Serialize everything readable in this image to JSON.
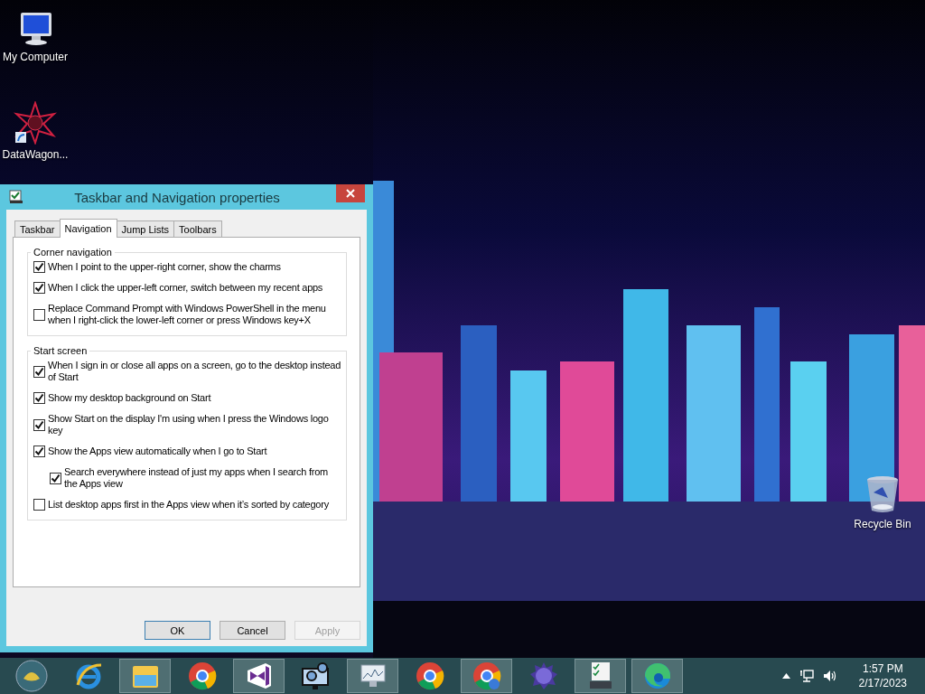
{
  "desktop_icons": [
    {
      "kind": "computer",
      "label": "My Computer"
    },
    {
      "kind": "app",
      "label": "DataWagon..."
    },
    {
      "kind": "recycle",
      "label": "Recycle Bin"
    }
  ],
  "dialog": {
    "title": "Taskbar and Navigation properties",
    "tabs": [
      {
        "label": "Taskbar",
        "selected": false
      },
      {
        "label": "Navigation",
        "selected": true
      },
      {
        "label": "Jump Lists",
        "selected": false
      },
      {
        "label": "Toolbars",
        "selected": false
      }
    ],
    "groups": [
      {
        "title": "Corner navigation",
        "options": [
          {
            "label": "When I point to the upper-right corner, show the charms",
            "checked": true
          },
          {
            "label": "When I click the upper-left corner, switch between my recent apps",
            "checked": true
          },
          {
            "label": "Replace Command Prompt with Windows PowerShell in the menu when I right-click the lower-left corner or press Windows key+X",
            "checked": false
          }
        ]
      },
      {
        "title": "Start screen",
        "options": [
          {
            "label": "When I sign in or close all apps on a screen, go to the desktop instead of Start",
            "checked": true
          },
          {
            "label": "Show my desktop background on Start",
            "checked": true
          },
          {
            "label": "Show Start on the display I'm using when I press the Windows logo key",
            "checked": true
          },
          {
            "label": "Show the Apps view automatically when I go to Start",
            "checked": true,
            "children": [
              {
                "label": "Search everywhere instead of just my apps when I search from the Apps view",
                "checked": true
              }
            ]
          },
          {
            "label": "List desktop apps first in the Apps view when it’s sorted by category",
            "checked": false
          }
        ]
      }
    ],
    "buttons": [
      {
        "label": "OK",
        "default": true,
        "disabled": false
      },
      {
        "label": "Cancel",
        "default": false,
        "disabled": false
      },
      {
        "label": "Apply",
        "default": false,
        "disabled": true
      }
    ]
  },
  "taskbar": {
    "items": [
      {
        "kind": "start",
        "active": false
      },
      {
        "kind": "ie",
        "active": false
      },
      {
        "kind": "explorer",
        "active": true
      },
      {
        "kind": "chrome",
        "active": false
      },
      {
        "kind": "vs",
        "active": true
      },
      {
        "kind": "gears",
        "active": false
      },
      {
        "kind": "monitor",
        "active": true
      },
      {
        "kind": "chrome",
        "active": false
      },
      {
        "kind": "chrome-chat",
        "active": true
      },
      {
        "kind": "ball",
        "active": false
      },
      {
        "kind": "checklist",
        "active": true
      },
      {
        "kind": "edge",
        "active": true
      }
    ],
    "time": "1:57 PM",
    "date": "2/17/2023"
  }
}
